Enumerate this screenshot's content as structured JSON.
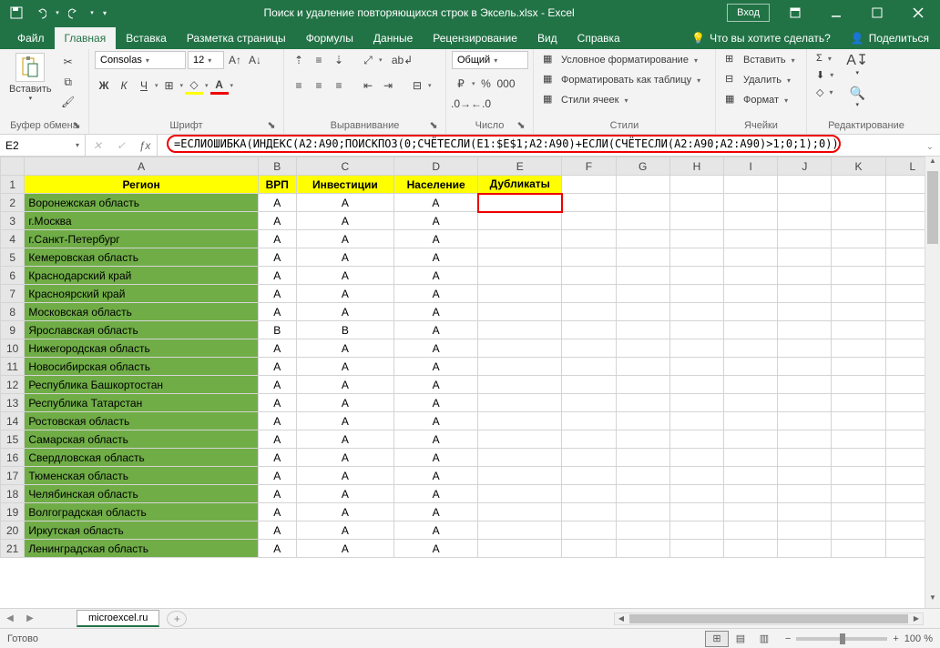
{
  "title": "Поиск и удаление повторяющихся строк в Эксель.xlsx  -  Excel",
  "login": "Вход",
  "tabs": [
    "Файл",
    "Главная",
    "Вставка",
    "Разметка страницы",
    "Формулы",
    "Данные",
    "Рецензирование",
    "Вид",
    "Справка"
  ],
  "tell": "Что вы хотите сделать?",
  "share": "Поделиться",
  "ribbon": {
    "clipboard": {
      "paste": "Вставить",
      "group": "Буфер обмена"
    },
    "font": {
      "name": "Consolas",
      "size": "12",
      "group": "Шрифт"
    },
    "align": {
      "group": "Выравнивание"
    },
    "number": {
      "format": "Общий",
      "group": "Число"
    },
    "styles": {
      "cond": "Условное форматирование",
      "table": "Форматировать как таблицу",
      "cell": "Стили ячеек",
      "group": "Стили"
    },
    "cells": {
      "insert": "Вставить",
      "delete": "Удалить",
      "format": "Формат",
      "group": "Ячейки"
    },
    "editing": {
      "group": "Редактирование"
    }
  },
  "namebox": "E2",
  "formula": "=ЕСЛИОШИБКА(ИНДЕКС(A2:A90;ПОИСКПОЗ(0;СЧЁТЕСЛИ(E1:$E$1;A2:A90)+ЕСЛИ(СЧЁТЕСЛИ(A2:A90;A2:A90)>1;0;1);0));",
  "cols": [
    "A",
    "B",
    "C",
    "D",
    "E",
    "F",
    "G",
    "H",
    "I",
    "J",
    "K",
    "L"
  ],
  "headers": [
    "Регион",
    "ВРП",
    "Инвестиции",
    "Население",
    "Дубликаты"
  ],
  "rows": [
    {
      "n": 2,
      "r": "Воронежская область",
      "b": "А",
      "c": "А",
      "d": "А"
    },
    {
      "n": 3,
      "r": "г.Москва",
      "b": "А",
      "c": "А",
      "d": "А"
    },
    {
      "n": 4,
      "r": "г.Санкт-Петербург",
      "b": "А",
      "c": "А",
      "d": "А"
    },
    {
      "n": 5,
      "r": "Кемеровская область",
      "b": "А",
      "c": "А",
      "d": "А"
    },
    {
      "n": 6,
      "r": "Краснодарский край",
      "b": "А",
      "c": "А",
      "d": "А"
    },
    {
      "n": 7,
      "r": "Красноярский край",
      "b": "А",
      "c": "А",
      "d": "А"
    },
    {
      "n": 8,
      "r": "Московская область",
      "b": "А",
      "c": "А",
      "d": "А"
    },
    {
      "n": 9,
      "r": "Ярославская область",
      "b": "В",
      "c": "В",
      "d": "А"
    },
    {
      "n": 10,
      "r": "Нижегородская область",
      "b": "А",
      "c": "А",
      "d": "А"
    },
    {
      "n": 11,
      "r": "Новосибирская область",
      "b": "А",
      "c": "А",
      "d": "А"
    },
    {
      "n": 12,
      "r": "Республика Башкортостан",
      "b": "А",
      "c": "А",
      "d": "А"
    },
    {
      "n": 13,
      "r": "Республика Татарстан",
      "b": "А",
      "c": "А",
      "d": "А"
    },
    {
      "n": 14,
      "r": "Ростовская область",
      "b": "А",
      "c": "А",
      "d": "А"
    },
    {
      "n": 15,
      "r": "Самарская область",
      "b": "А",
      "c": "А",
      "d": "А"
    },
    {
      "n": 16,
      "r": "Свердловская область",
      "b": "А",
      "c": "А",
      "d": "А"
    },
    {
      "n": 17,
      "r": "Тюменская область",
      "b": "А",
      "c": "А",
      "d": "А"
    },
    {
      "n": 18,
      "r": "Челябинская область",
      "b": "А",
      "c": "А",
      "d": "А"
    },
    {
      "n": 19,
      "r": "Волгоградская область",
      "b": "А",
      "c": "А",
      "d": "А"
    },
    {
      "n": 20,
      "r": "Иркутская область",
      "b": "А",
      "c": "А",
      "d": "А"
    },
    {
      "n": 21,
      "r": "Ленинградская область",
      "b": "А",
      "c": "А",
      "d": "А"
    }
  ],
  "sheettab": "microexcel.ru",
  "status": "Готово",
  "zoom": "100 %"
}
